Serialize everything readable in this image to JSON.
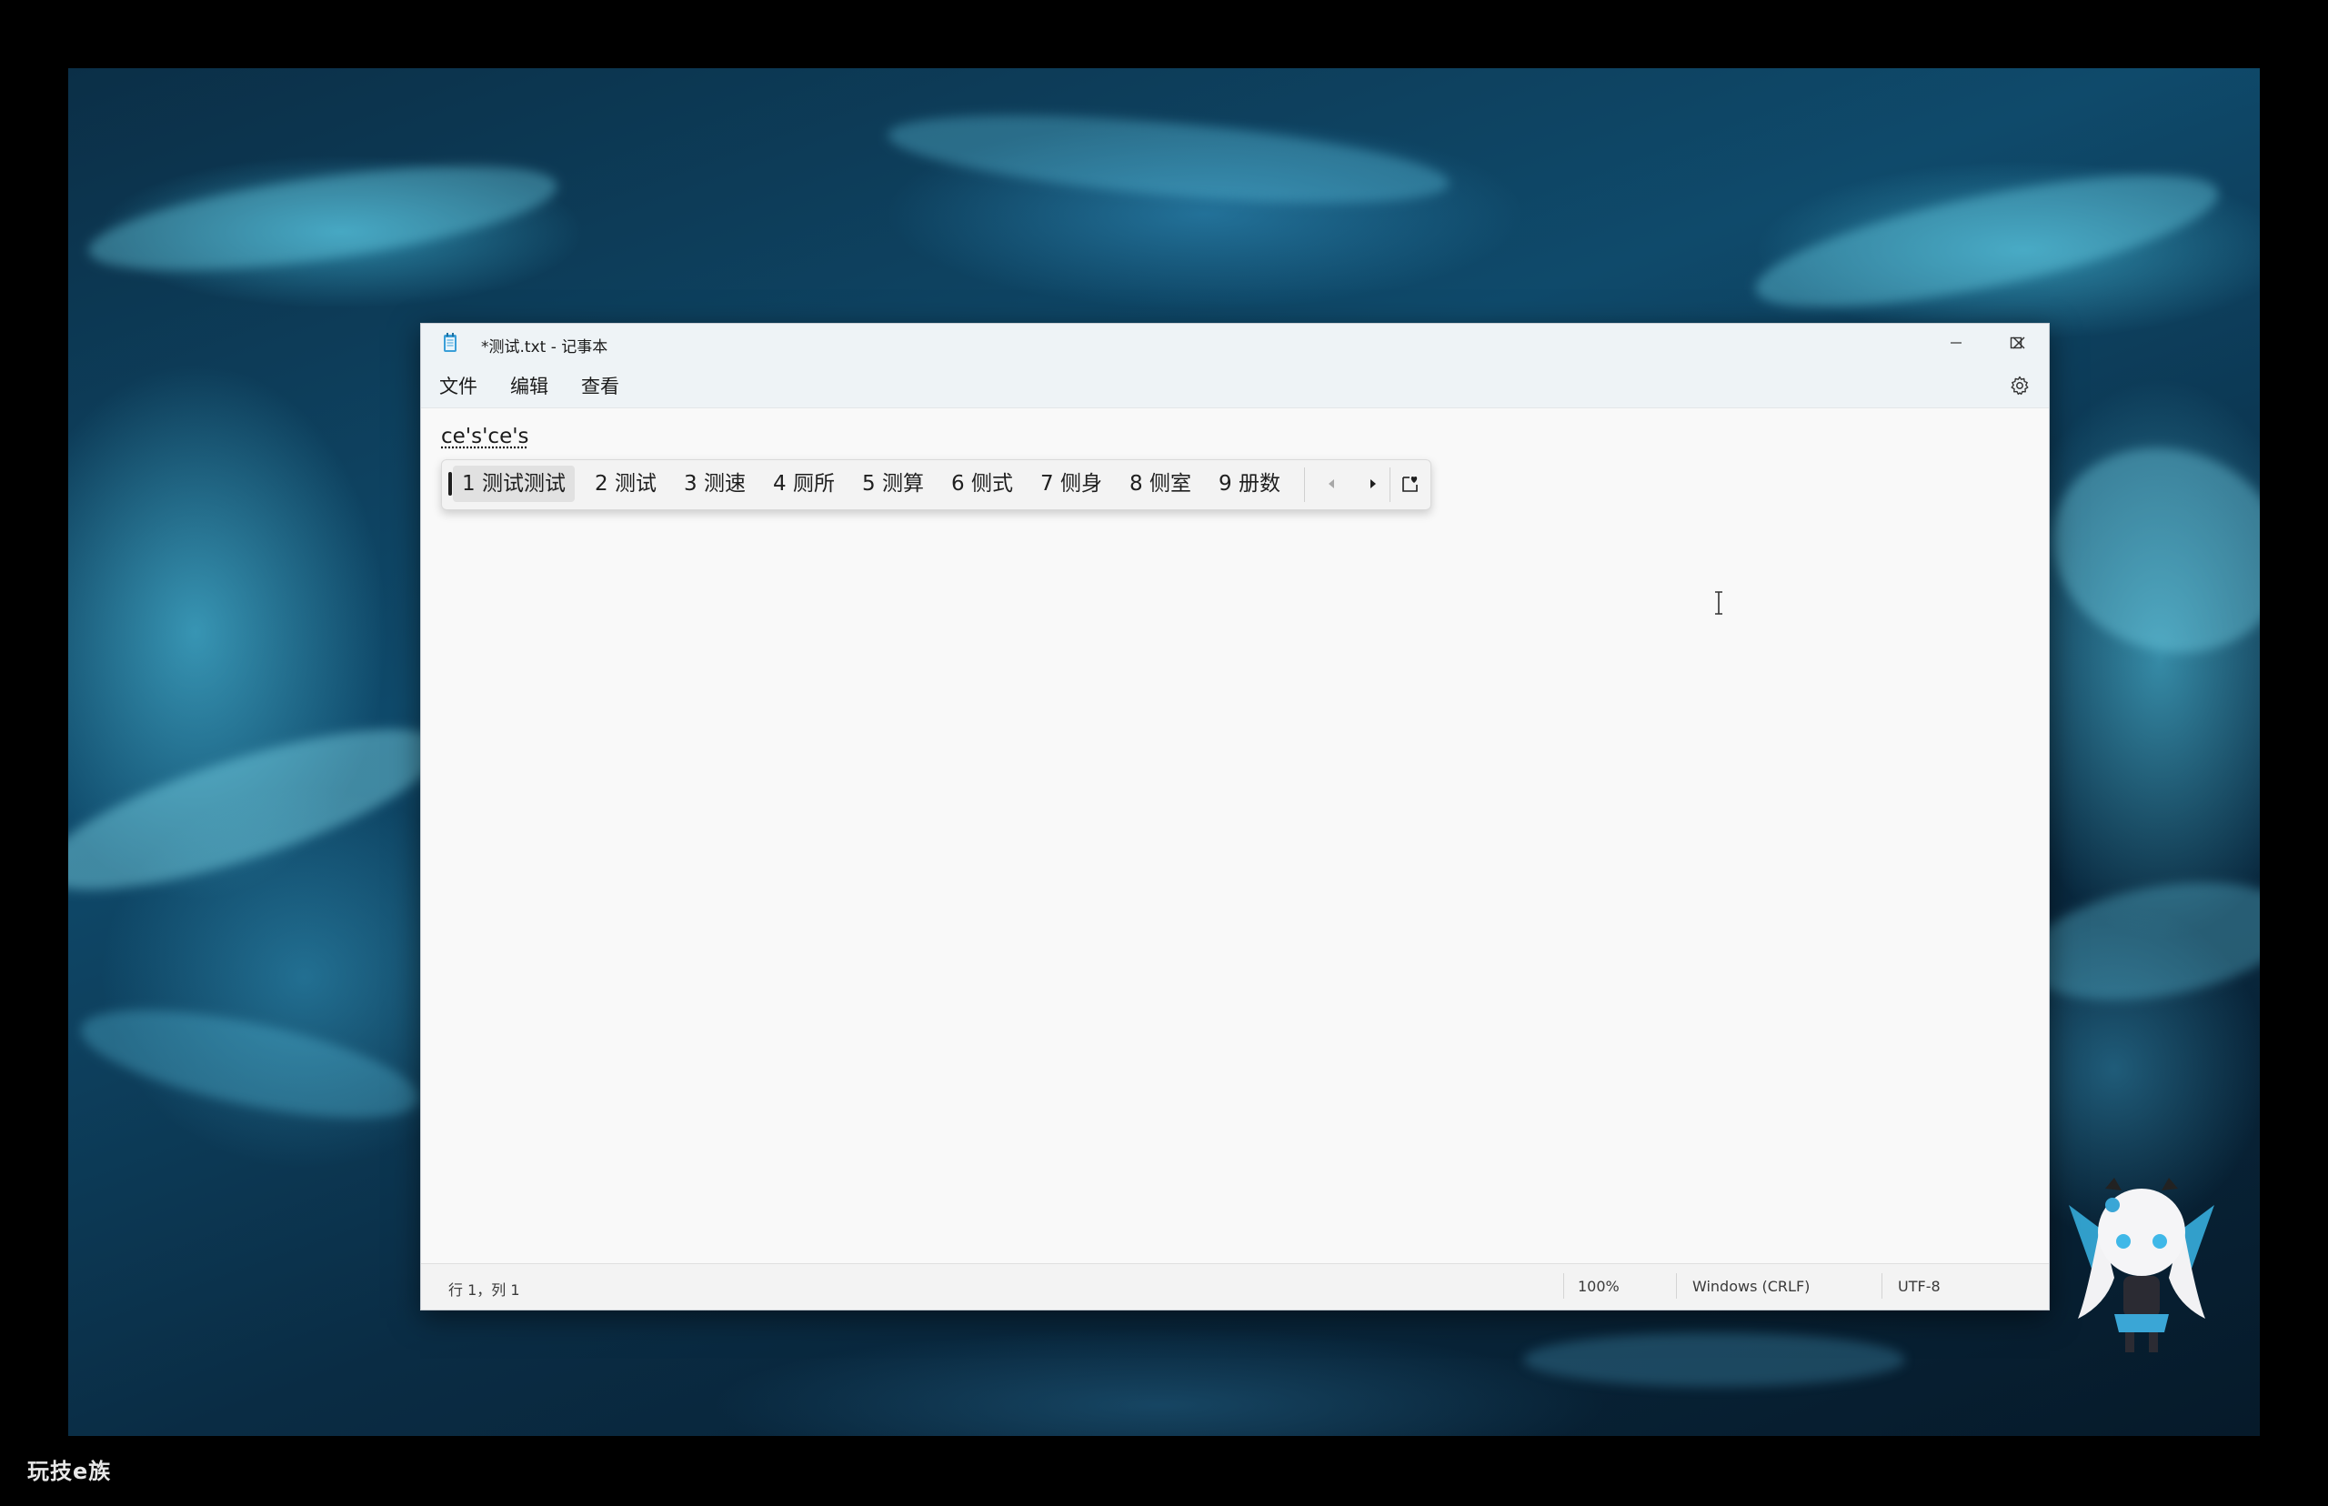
{
  "window": {
    "title": "*测试.txt - 记事本"
  },
  "menu": {
    "file": "文件",
    "edit": "编辑",
    "view": "查看"
  },
  "editor": {
    "composition_text": "ce's'ce's"
  },
  "ime": {
    "candidates": [
      {
        "index": "1",
        "text": "测试测试",
        "selected": true
      },
      {
        "index": "2",
        "text": "测试"
      },
      {
        "index": "3",
        "text": "测速"
      },
      {
        "index": "4",
        "text": "厕所"
      },
      {
        "index": "5",
        "text": "测算"
      },
      {
        "index": "6",
        "text": "侧式"
      },
      {
        "index": "7",
        "text": "侧身"
      },
      {
        "index": "8",
        "text": "侧室"
      },
      {
        "index": "9",
        "text": "册数"
      }
    ]
  },
  "statusbar": {
    "position": "行 1，列 1",
    "zoom": "100%",
    "line_ending": "Windows (CRLF)",
    "encoding": "UTF-8"
  },
  "watermark": "玩技e族",
  "icons": {
    "app": "notepad-icon",
    "minimize": "minimize-icon",
    "maximize": "maximize-icon",
    "close": "close-icon",
    "settings": "gear-icon",
    "prev": "triangle-left-icon",
    "next": "triangle-right-icon",
    "favorite": "heart-page-icon"
  },
  "colors": {
    "titlebar": "#eef3f6",
    "editor": "#f9f9f9",
    "candidate_selected": "#e1e1e1"
  }
}
